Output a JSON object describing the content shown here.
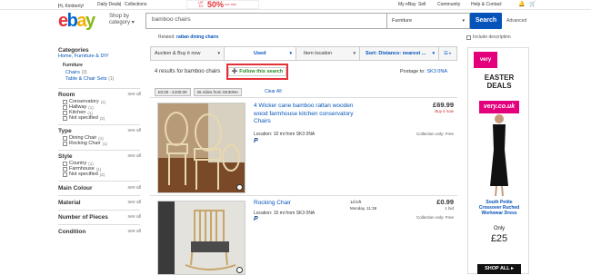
{
  "topbar": {
    "greeting": "Hi, Kimberly!",
    "daily_deals": "Daily Deals",
    "collections": "Collections",
    "promo_up": "UP TO",
    "promo_pct": "50%",
    "promo_off": "OFF RRP",
    "my_ebay": "My eBay",
    "sell": "Sell",
    "community": "Community",
    "help": "Help & Contact"
  },
  "header": {
    "logo": [
      "e",
      "b",
      "a",
      "y"
    ],
    "shop_by": "Shop by",
    "category": "category",
    "search_value": "bamboo chairs",
    "category_select": "Furniture",
    "search_button": "Search",
    "advanced": "Advanced",
    "related_label": "Related:",
    "related_link": "rattan dining chairs",
    "include_description": "Include description"
  },
  "sidebar": {
    "categories_title": "Categories",
    "cat_path": "Home, Furniture & DIY",
    "furniture": "Furniture",
    "chairs": "Chairs",
    "chairs_count": "(3)",
    "table_chair_sets": "Table & Chair Sets",
    "table_chair_sets_count": "(1)",
    "see_all": "see all",
    "facets": [
      {
        "title": "Room",
        "items": [
          [
            "Conservatory",
            "(1)"
          ],
          [
            "Hallway",
            "(1)"
          ],
          [
            "Kitchen",
            "(1)"
          ],
          [
            "Not specified",
            "(2)"
          ]
        ]
      },
      {
        "title": "Type",
        "items": [
          [
            "Dining Chair",
            "(1)"
          ],
          [
            "Rocking Chair",
            "(1)"
          ]
        ]
      },
      {
        "title": "Style",
        "items": [
          [
            "Country",
            "(1)"
          ],
          [
            "Farmhouse",
            "(1)"
          ],
          [
            "Not specified",
            "(2)"
          ]
        ]
      }
    ],
    "more_facets": [
      "Main Colour",
      "Material",
      "Number of Pieces",
      "Condition"
    ]
  },
  "tabs": {
    "format": "Auction & Buy it now",
    "used": "Used",
    "item_location": "Item location",
    "sort": "Sort: Distance: nearest ..."
  },
  "results": {
    "count_text": "4 results for",
    "query": "bamboo chairs",
    "follow": "Follow this search",
    "postage_label": "Postage to:",
    "postage_code": "SK3 0NA",
    "chips": [
      "£0.00 - £100.00",
      "25 miles from SK30NA"
    ],
    "clear_all": "Clear All"
  },
  "items": [
    {
      "title": "4 Wicker cane bamboo rattan wooden wood farmhouse kitchen conservatory Chairs",
      "location": "Location:",
      "distance": "10 mi from SK3 0NA",
      "price": "£69.99",
      "buy_it_now": "Buy it now",
      "collection": "Collection only: Free"
    },
    {
      "title": "Rocking Chair",
      "location": "Location:",
      "distance": "15 mi from SK3 0NA",
      "time_left": "1d left",
      "end_time": "Monday, 11:38",
      "price": "£0.99",
      "bids": "1 bid",
      "collection": "Collection only: Free"
    }
  ],
  "ad": {
    "brand": "very.co.uk",
    "headline1": "EASTER",
    "headline2": "DEALS",
    "product1": "South Petite",
    "product2": "Crossover Ruched",
    "product3": "Workwear Dress",
    "only": "Only",
    "price": "£25",
    "cta": "SHOP ALL ▸"
  },
  "colors": {
    "ebay_red": "#e53238",
    "ebay_blue": "#0064d2",
    "ebay_yellow": "#f5af02",
    "ebay_green": "#86b817",
    "link": "#0654ba",
    "very_pink": "#e4007c"
  }
}
